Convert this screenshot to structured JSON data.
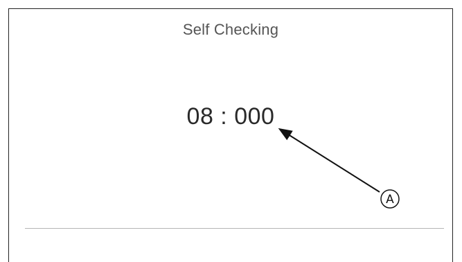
{
  "screen": {
    "title": "Self Checking",
    "counter": "08 : 000"
  },
  "callout": {
    "label": "A",
    "icon": "arrow-icon"
  }
}
